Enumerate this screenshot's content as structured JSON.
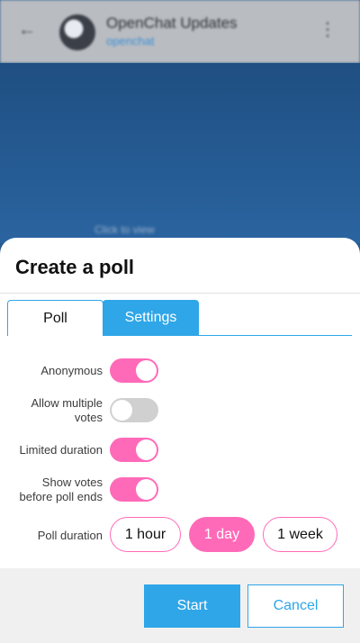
{
  "background": {
    "chat_title": "OpenChat Updates",
    "chat_subtitle": "openchat",
    "hint": "Click to view",
    "back_icon": "back-arrow-icon",
    "menu_icon": "kebab-menu-icon"
  },
  "dialog": {
    "title": "Create a poll",
    "tabs": [
      {
        "label": "Poll",
        "active": false
      },
      {
        "label": "Settings",
        "active": true
      }
    ],
    "settings": {
      "anonymous": {
        "label": "Anonymous",
        "on": true
      },
      "allow_multiple": {
        "label_line1": "Allow multiple",
        "label_line2": "votes",
        "on": false
      },
      "limited_duration": {
        "label": "Limited duration",
        "on": true
      },
      "show_votes": {
        "label_line1": "Show votes",
        "label_line2": "before poll ends",
        "on": true
      }
    },
    "duration": {
      "label": "Poll duration",
      "options": [
        "1 hour",
        "1 day",
        "1 week"
      ],
      "selected": "1 day"
    },
    "buttons": {
      "start": "Start",
      "cancel": "Cancel"
    }
  },
  "colors": {
    "accent_blue": "#2fa6e8",
    "accent_pink": "#ff6ab8",
    "toggle_off": "#d0d0d0",
    "footer_bg": "#f0f0f0"
  }
}
